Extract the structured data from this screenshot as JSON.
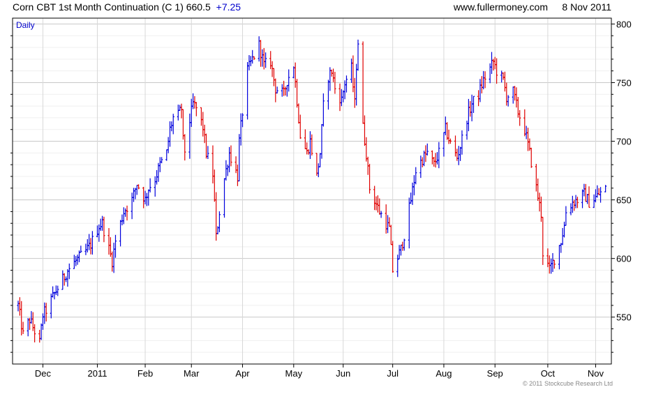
{
  "header": {
    "instrument": "Corn CBT 1st Month Continuation (C 1) 660.5",
    "change": "+7.25",
    "website": "www.fullermoney.com",
    "date": "8 Nov 2011"
  },
  "frequency_label": "Daily",
  "copyright": "© 2011 Stockcube Research Ltd",
  "colors": {
    "up": "#0000dd",
    "down": "#e00000",
    "change_text": "#0000cc",
    "grid": "#dcdcdc",
    "axis": "#000000"
  },
  "chart_data": {
    "type": "ohlc",
    "x_axis": {
      "range": [
        "2010-11-16",
        "2011-11-08"
      ],
      "tick_labels": [
        {
          "label": "Dec",
          "date": "2010-12-01"
        },
        {
          "label": "2011",
          "date": "2011-01-03"
        },
        {
          "label": "Feb",
          "date": "2011-02-01"
        },
        {
          "label": "Mar",
          "date": "2011-03-01"
        },
        {
          "label": "Apr",
          "date": "2011-04-01"
        },
        {
          "label": "May",
          "date": "2011-05-02"
        },
        {
          "label": "Jun",
          "date": "2011-06-01"
        },
        {
          "label": "Jul",
          "date": "2011-07-01"
        },
        {
          "label": "Aug",
          "date": "2011-08-01"
        },
        {
          "label": "Sep",
          "date": "2011-09-01"
        },
        {
          "label": "Oct",
          "date": "2011-10-03"
        },
        {
          "label": "Nov",
          "date": "2011-11-01"
        }
      ]
    },
    "y_axis": {
      "range": [
        510,
        805
      ],
      "ticks": [
        550,
        600,
        650,
        700,
        750,
        800
      ],
      "position": "right"
    },
    "grid": true,
    "series": [
      {
        "closes": [
          [
            560,
            "2010-11-16"
          ],
          [
            535,
            "2010-11-19"
          ],
          [
            548,
            "2010-11-23"
          ],
          [
            528,
            "2010-11-29"
          ],
          [
            552,
            "2010-12-01"
          ],
          [
            556,
            "2010-12-03"
          ],
          [
            570,
            "2010-12-08"
          ],
          [
            582,
            "2010-12-13"
          ],
          [
            590,
            "2010-12-16"
          ],
          [
            598,
            "2010-12-21"
          ],
          [
            606,
            "2010-12-27"
          ],
          [
            612,
            "2010-12-30"
          ],
          [
            628,
            "2011-01-04"
          ],
          [
            630,
            "2011-01-06"
          ],
          [
            608,
            "2011-01-10"
          ],
          [
            598,
            "2011-01-12"
          ],
          [
            615,
            "2011-01-14"
          ],
          [
            640,
            "2011-01-19"
          ],
          [
            650,
            "2011-01-24"
          ],
          [
            664,
            "2011-01-27"
          ],
          [
            650,
            "2011-02-01"
          ],
          [
            660,
            "2011-02-03"
          ],
          [
            668,
            "2011-02-07"
          ],
          [
            680,
            "2011-02-10"
          ],
          [
            690,
            "2011-02-14"
          ],
          [
            710,
            "2011-02-16"
          ],
          [
            720,
            "2011-02-18"
          ],
          [
            722,
            "2011-02-21"
          ],
          [
            728,
            "2011-02-23"
          ],
          [
            700,
            "2011-02-24"
          ],
          [
            692,
            "2011-02-25"
          ],
          [
            718,
            "2011-02-28"
          ],
          [
            732,
            "2011-03-02"
          ],
          [
            728,
            "2011-03-04"
          ],
          [
            712,
            "2011-03-08"
          ],
          [
            690,
            "2011-03-10"
          ],
          [
            672,
            "2011-03-14"
          ],
          [
            648,
            "2011-03-15"
          ],
          [
            618,
            "2011-03-16"
          ],
          [
            640,
            "2011-03-18"
          ],
          [
            668,
            "2011-03-21"
          ],
          [
            690,
            "2011-03-24"
          ],
          [
            670,
            "2011-03-29"
          ],
          [
            700,
            "2011-03-30"
          ],
          [
            725,
            "2011-04-01"
          ],
          [
            760,
            "2011-04-04"
          ],
          [
            770,
            "2011-04-07"
          ],
          [
            782,
            "2011-04-11"
          ],
          [
            765,
            "2011-04-14"
          ],
          [
            768,
            "2011-04-18"
          ],
          [
            745,
            "2011-04-21"
          ],
          [
            740,
            "2011-04-26"
          ],
          [
            752,
            "2011-04-28"
          ],
          [
            765,
            "2011-05-02"
          ],
          [
            735,
            "2011-05-04"
          ],
          [
            705,
            "2011-05-06"
          ],
          [
            690,
            "2011-05-10"
          ],
          [
            700,
            "2011-05-12"
          ],
          [
            670,
            "2011-05-16"
          ],
          [
            690,
            "2011-05-18"
          ],
          [
            730,
            "2011-05-20"
          ],
          [
            755,
            "2011-05-23"
          ],
          [
            760,
            "2011-05-25"
          ],
          [
            745,
            "2011-05-27"
          ],
          [
            735,
            "2011-05-31"
          ],
          [
            750,
            "2011-06-02"
          ],
          [
            762,
            "2011-06-06"
          ],
          [
            732,
            "2011-06-08"
          ],
          [
            765,
            "2011-06-09"
          ],
          [
            785,
            "2011-06-10"
          ],
          [
            712,
            "2011-06-13"
          ],
          [
            690,
            "2011-06-15"
          ],
          [
            660,
            "2011-06-17"
          ],
          [
            650,
            "2011-06-20"
          ],
          [
            640,
            "2011-06-23"
          ],
          [
            630,
            "2011-06-27"
          ],
          [
            625,
            "2011-06-29"
          ],
          [
            590,
            "2011-07-01"
          ],
          [
            608,
            "2011-07-06"
          ],
          [
            620,
            "2011-07-08"
          ],
          [
            650,
            "2011-07-12"
          ],
          [
            675,
            "2011-07-15"
          ],
          [
            685,
            "2011-07-19"
          ],
          [
            690,
            "2011-07-22"
          ],
          [
            680,
            "2011-07-26"
          ],
          [
            690,
            "2011-07-29"
          ],
          [
            710,
            "2011-08-02"
          ],
          [
            698,
            "2011-08-05"
          ],
          [
            686,
            "2011-08-09"
          ],
          [
            696,
            "2011-08-11"
          ],
          [
            720,
            "2011-08-15"
          ],
          [
            732,
            "2011-08-18"
          ],
          [
            740,
            "2011-08-22"
          ],
          [
            752,
            "2011-08-25"
          ],
          [
            762,
            "2011-08-29"
          ],
          [
            768,
            "2011-08-31"
          ],
          [
            760,
            "2011-09-02"
          ],
          [
            752,
            "2011-09-06"
          ],
          [
            738,
            "2011-09-08"
          ],
          [
            742,
            "2011-09-12"
          ],
          [
            725,
            "2011-09-15"
          ],
          [
            710,
            "2011-09-19"
          ],
          [
            690,
            "2011-09-22"
          ],
          [
            660,
            "2011-09-26"
          ],
          [
            638,
            "2011-09-29"
          ],
          [
            605,
            "2011-09-30"
          ],
          [
            590,
            "2011-10-04"
          ],
          [
            600,
            "2011-10-07"
          ],
          [
            615,
            "2011-10-11"
          ],
          [
            628,
            "2011-10-13"
          ],
          [
            640,
            "2011-10-14"
          ],
          [
            648,
            "2011-10-18"
          ],
          [
            650,
            "2011-10-21"
          ],
          [
            655,
            "2011-10-25"
          ],
          [
            648,
            "2011-10-28"
          ],
          [
            652,
            "2011-11-01"
          ],
          [
            656,
            "2011-11-04"
          ],
          [
            660.5,
            "2011-11-08"
          ]
        ]
      }
    ]
  }
}
